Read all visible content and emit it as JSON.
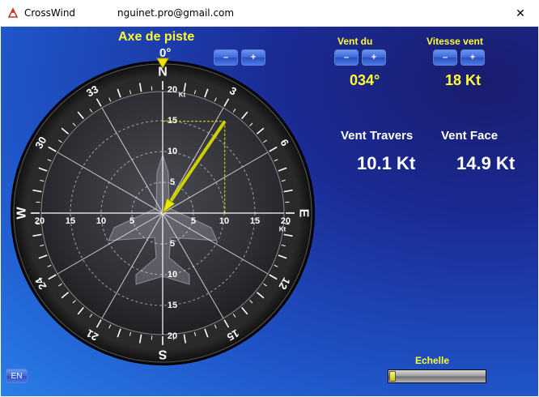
{
  "window": {
    "app_title": "CrossWind",
    "user_email": "nguinet.pro@gmail.com",
    "close_glyph": "✕"
  },
  "runway": {
    "label": "Axe de piste",
    "value": "0°",
    "minus_label": "–",
    "plus_label": "+"
  },
  "wind_from": {
    "label": "Vent du",
    "value": "034°",
    "minus_label": "–",
    "plus_label": "+"
  },
  "wind_speed": {
    "label": "Vitesse vent",
    "value": "18 Kt",
    "minus_label": "–",
    "plus_label": "+"
  },
  "results": {
    "crosswind_label": "Vent Travers",
    "crosswind_value": "10.1 Kt",
    "headwind_label": "Vent Face",
    "headwind_value": "14.9 Kt"
  },
  "compass": {
    "cardinals": {
      "n": "N",
      "e": "E",
      "s": "S",
      "w": "W"
    },
    "headings": [
      {
        "label": "3",
        "deg": 30
      },
      {
        "label": "6",
        "deg": 60
      },
      {
        "label": "12",
        "deg": 120
      },
      {
        "label": "15",
        "deg": 150
      },
      {
        "label": "21",
        "deg": 210
      },
      {
        "label": "24",
        "deg": 240
      },
      {
        "label": "30",
        "deg": 300
      },
      {
        "label": "33",
        "deg": 330
      }
    ],
    "grid_labels": [
      "5",
      "10",
      "15",
      "20"
    ],
    "unit": "Kt",
    "wind_direction_deg": 34,
    "wind_speed_kt": 18,
    "crosswind_kt": 10.1,
    "headwind_kt": 14.9,
    "runway_heading_deg": 0
  },
  "scale": {
    "label": "Echelle",
    "level": 0
  },
  "language_button": "EN",
  "colors": {
    "accent_yellow": "#ffff33",
    "dial_bezel": "#1a1a1a",
    "wind_arrow": "#d8d800"
  }
}
